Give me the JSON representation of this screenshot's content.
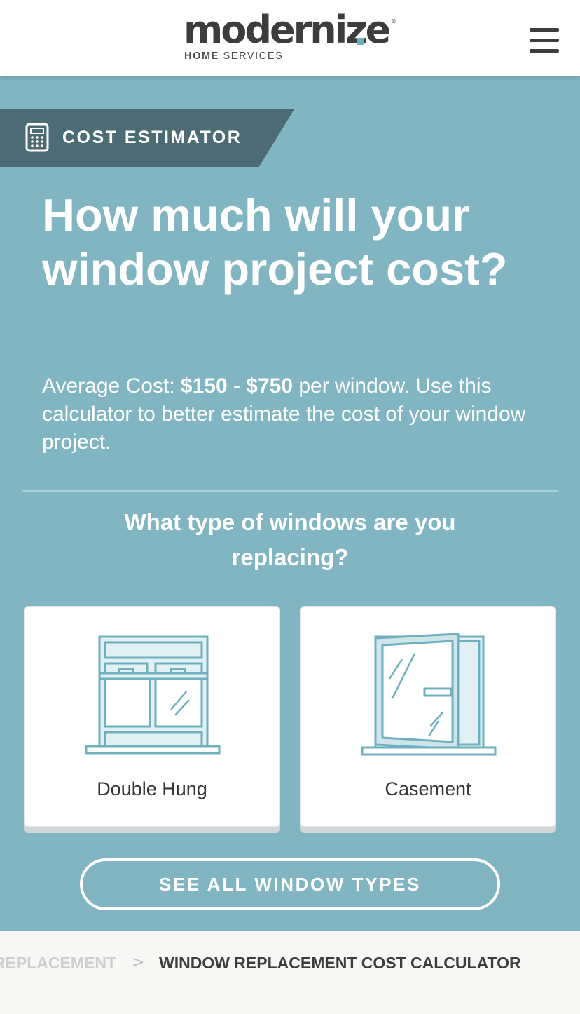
{
  "header": {
    "logo_text": "moderniz",
    "logo_tail": "e",
    "logo_sub_bold": "HOME",
    "logo_sub_light": " SERVICES",
    "logo_registered": "®",
    "menu_icon": "hamburger-icon"
  },
  "badge": {
    "icon": "calculator-icon",
    "label": "COST ESTIMATOR"
  },
  "hero": {
    "title": "How much will your window project cost?",
    "desc_prefix": "Average Cost: ",
    "desc_price": "$150 - $750",
    "desc_suffix": " per window. Use this calculator to better estimate the cost of your window project."
  },
  "question": "What type of windows are you replacing?",
  "options": [
    {
      "label": "Double Hung",
      "icon": "double-hung-window-icon"
    },
    {
      "label": "Casement",
      "icon": "casement-window-icon"
    }
  ],
  "see_all_label": "SEE ALL WINDOW TYPES",
  "breadcrumb": {
    "previous": "REPLACEMENT",
    "separator": ">",
    "current": "WINDOW REPLACEMENT COST CALCULATOR"
  },
  "colors": {
    "hero_bg": "#80b5c1",
    "badge_bg": "#4c6b74",
    "icon_stroke": "#6fb0bf",
    "icon_fill": "#e2f0f3",
    "text_dark": "#3d3d3d"
  }
}
